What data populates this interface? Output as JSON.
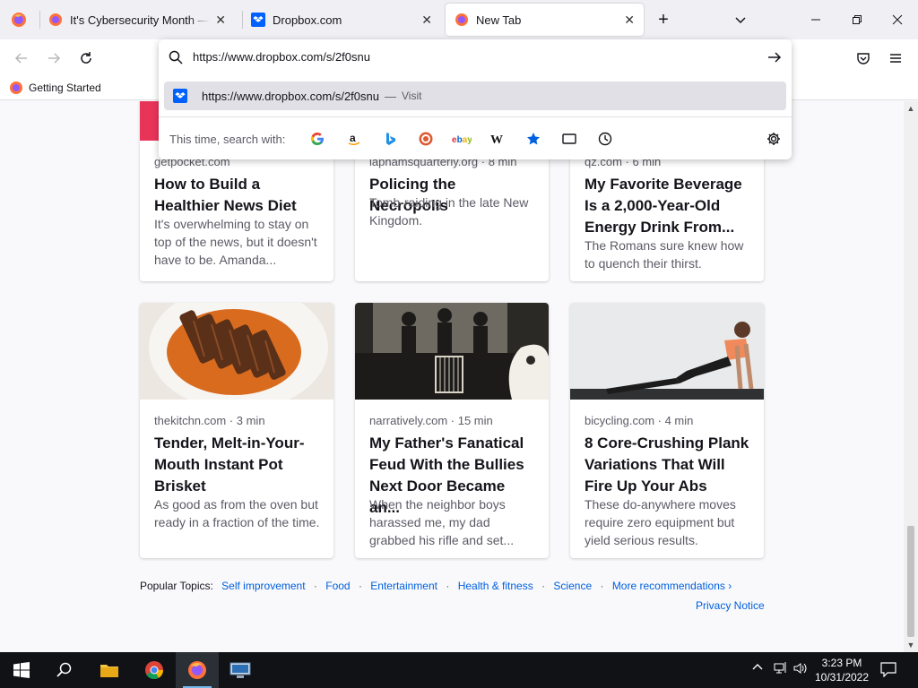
{
  "tabs": [
    {
      "label": "It's Cybersecurity Month — tim",
      "close": "✕"
    },
    {
      "label": "Dropbox.com",
      "close": "✕"
    },
    {
      "label": "New Tab",
      "close": "✕"
    }
  ],
  "tabstrip": {
    "new_tab": "+",
    "list_all": "⌄",
    "minimize": "—",
    "restore": "❐",
    "close": "✕"
  },
  "urlbar": {
    "value": "https://www.dropbox.com/s/2f0snu",
    "result_url": "https://www.dropbox.com/s/2f0snu",
    "result_dash": "—",
    "result_action": "Visit",
    "engines_label": "This time, search with:"
  },
  "bookmarks": [
    {
      "label": "Getting Started"
    }
  ],
  "cards": [
    {
      "source": "getpocket.com",
      "title": "How to Build a Healthier News Diet",
      "excerpt": "It's overwhelming to stay on top of the news, but it doesn't have to be. Amanda..."
    },
    {
      "source": "laphamsquarterly.org · 8 min",
      "title": "Policing the Necropolis",
      "excerpt": "Tomb-raiding in the late New Kingdom."
    },
    {
      "source": "qz.com · 6 min",
      "title": "My Favorite Beverage Is a 2,000-Year-Old Energy Drink From...",
      "excerpt": "The Romans sure knew how to quench their thirst."
    },
    {
      "source": "thekitchn.com · 3 min",
      "title": "Tender, Melt-in-Your-Mouth Instant Pot Brisket",
      "excerpt": "As good as from the oven but ready in a fraction of the time."
    },
    {
      "source": "narratively.com · 15 min",
      "title": "My Father's Fanatical Feud With the Bullies Next Door Became an...",
      "excerpt": "When the neighbor boys harassed me, my dad grabbed his rifle and set..."
    },
    {
      "source": "bicycling.com · 4 min",
      "title": "8 Core-Crushing Plank Variations That Will Fire Up Your Abs",
      "excerpt": "These do-anywhere moves require zero equipment but yield serious results."
    }
  ],
  "topics": {
    "label": "Popular Topics:",
    "items": [
      "Self improvement",
      "Food",
      "Entertainment",
      "Health & fitness",
      "Science"
    ],
    "more": "More recommendations ›",
    "separator": "·"
  },
  "privacy": "Privacy Notice",
  "taskbar": {
    "time": "3:23 PM",
    "date": "10/31/2022"
  },
  "icons": {
    "search_engines": [
      "google-icon",
      "amazon-icon",
      "bing-icon",
      "duckduckgo-icon",
      "ebay-icon",
      "wikipedia-icon",
      "bookmarks-icon",
      "tabs-icon",
      "history-icon"
    ]
  },
  "colors": {
    "accent": "#0060df",
    "tab_strip": "#f0f0f4",
    "taskbar": "#101216",
    "result_highlight": "#e0e0e6"
  }
}
